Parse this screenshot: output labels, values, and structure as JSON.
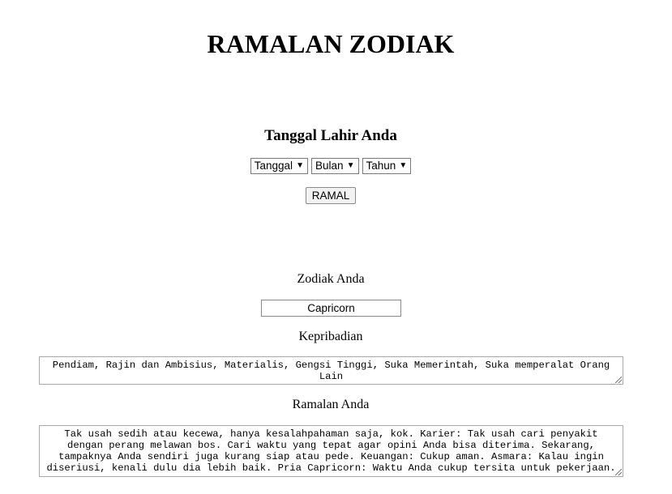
{
  "header": {
    "title": "RAMALAN ZODIAK"
  },
  "form": {
    "subtitle": "Tanggal Lahir Anda",
    "day_select": "Tanggal",
    "month_select": "Bulan",
    "year_select": "Tahun",
    "submit_label": "RAMAL"
  },
  "result": {
    "zodiac_label": "Zodiak Anda",
    "zodiac_value": "Capricorn",
    "personality_label": "Kepribadian",
    "personality_text": "Pendiam, Rajin dan Ambisius, Materialis, Gengsi Tinggi, Suka Memerintah, Suka memperalat Orang Lain",
    "forecast_label": "Ramalan Anda",
    "forecast_text": "Tak usah sedih atau kecewa, hanya kesalahpahaman saja, kok. Karier: Tak usah cari penyakit dengan perang melawan bos. Cari waktu yang tepat agar opini Anda bisa diterima. Sekarang, tampaknya Anda sendiri juga kurang siap atau pede. Keuangan: Cukup aman. Asmara: Kalau ingin diseriusi, kenali dulu dia lebih baik. Pria Capricorn: Waktu Anda cukup tersita untuk pekerjaan."
  }
}
